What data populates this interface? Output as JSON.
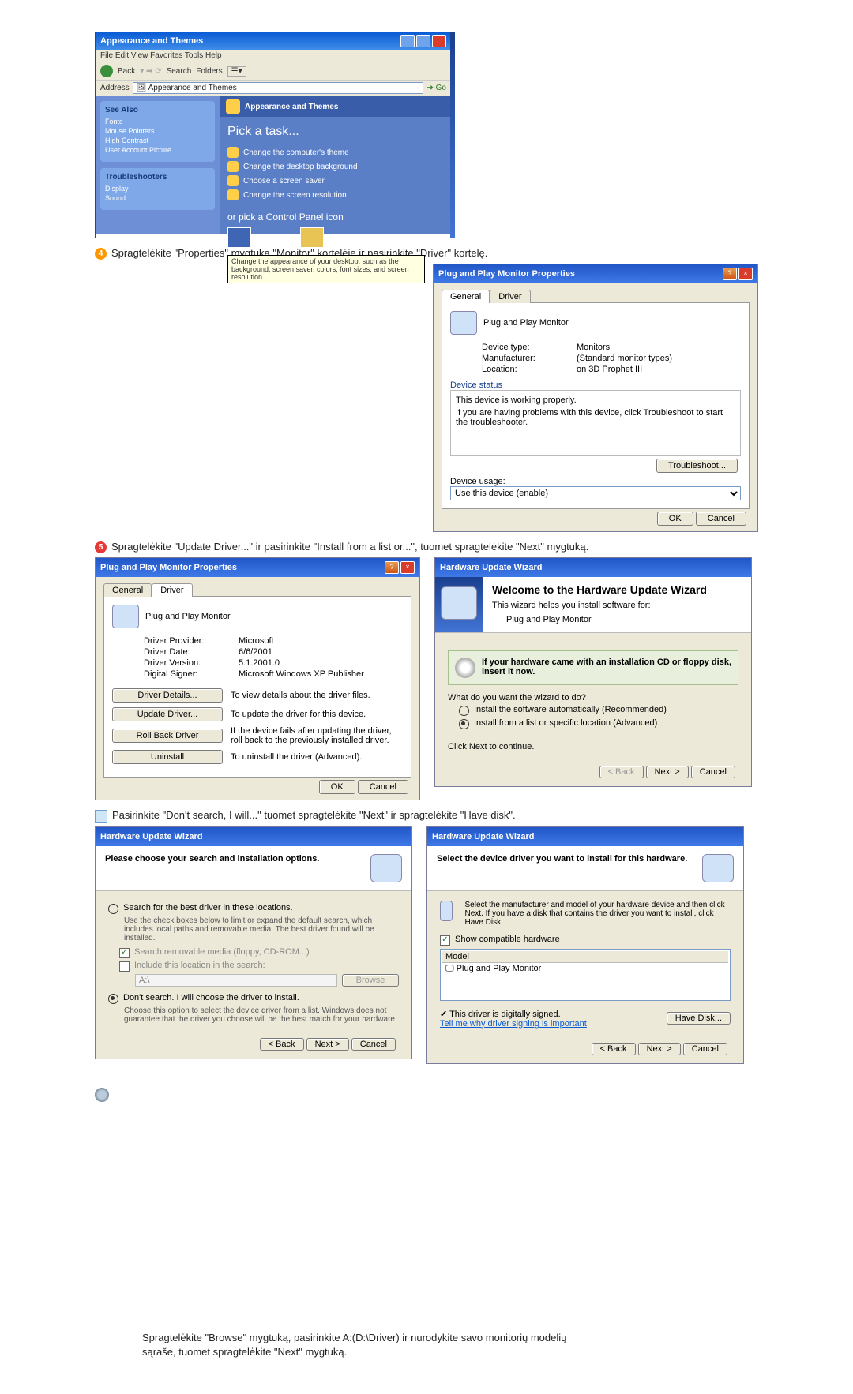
{
  "cp": {
    "title": "Appearance and Themes",
    "menu": "File  Edit  View  Favorites  Tools  Help",
    "back": "Back",
    "search": "Search",
    "folders": "Folders",
    "address_label": "Address",
    "address_value": "Appearance and Themes",
    "go": "Go",
    "side_seealso_hdr": "See Also",
    "side_seealso": [
      "Fonts",
      "Mouse Pointers",
      "High Contrast",
      "User Account Picture"
    ],
    "side_trouble_hdr": "Troubleshooters",
    "side_trouble": [
      "Display",
      "Sound"
    ],
    "main_header": "Appearance and Themes",
    "pick_task": "Pick a task...",
    "tasks": [
      "Change the computer's theme",
      "Change the desktop background",
      "Choose a screen saver",
      "Change the screen resolution"
    ],
    "or_pick": "or pick a Control Panel icon",
    "icon_display": "Display",
    "icon_folder": "Folder Options",
    "tooltip": "Change the appearance of your desktop, such as the background, screen saver, colors, font sizes, and screen resolution."
  },
  "instr4": "Spragtelėkite \"Properties\" mygtuką \"Monitor\" kortelėje ir pasirinkite \"Driver\" kortelę.",
  "props1": {
    "title": "Plug and Play Monitor Properties",
    "tab_general": "General",
    "tab_driver": "Driver",
    "heading": "Plug and Play Monitor",
    "devtype_k": "Device type:",
    "devtype_v": "Monitors",
    "manu_k": "Manufacturer:",
    "manu_v": "(Standard monitor types)",
    "loc_k": "Location:",
    "loc_v": "on 3D Prophet III",
    "status_hdr": "Device status",
    "status1": "This device is working properly.",
    "status2": "If you are having problems with this device, click Troubleshoot to start the troubleshooter.",
    "troubleshoot": "Troubleshoot...",
    "usage_lbl": "Device usage:",
    "usage_val": "Use this device (enable)",
    "ok": "OK",
    "cancel": "Cancel"
  },
  "instr5": "Spragtelėkite \"Update Driver...\" ir pasirinkite \"Install from a list or...\", tuomet spragtelėkite \"Next\" mygtuką.",
  "props2": {
    "title": "Plug and Play Monitor Properties",
    "tab_general": "General",
    "tab_driver": "Driver",
    "heading": "Plug and Play Monitor",
    "provider_k": "Driver Provider:",
    "provider_v": "Microsoft",
    "date_k": "Driver Date:",
    "date_v": "6/6/2001",
    "ver_k": "Driver Version:",
    "ver_v": "5.1.2001.0",
    "signer_k": "Digital Signer:",
    "signer_v": "Microsoft Windows XP Publisher",
    "btn_details": "Driver Details...",
    "btn_details_desc": "To view details about the driver files.",
    "btn_update": "Update Driver...",
    "btn_update_desc": "To update the driver for this device.",
    "btn_rollback": "Roll Back Driver",
    "btn_rollback_desc": "If the device fails after updating the driver, roll back to the previously installed driver.",
    "btn_uninstall": "Uninstall",
    "btn_uninstall_desc": "To uninstall the driver (Advanced).",
    "ok": "OK",
    "cancel": "Cancel"
  },
  "wiz1": {
    "title": "Hardware Update Wizard",
    "welcome": "Welcome to the Hardware Update Wizard",
    "intro": "This wizard helps you install software for:",
    "device": "Plug and Play Monitor",
    "cd_msg": "If your hardware came with an installation CD or floppy disk, insert it now.",
    "q": "What do you want the wizard to do?",
    "opt_auto": "Install the software automatically (Recommended)",
    "opt_list": "Install from a list or specific location (Advanced)",
    "cont": "Click Next to continue.",
    "back": "< Back",
    "next": "Next >",
    "cancel": "Cancel"
  },
  "instr6": "Pasirinkite \"Don't search, I will...\" tuomet spragtelėkite \"Next\" ir spragtelėkite \"Have disk\".",
  "wiz2": {
    "title": "Hardware Update Wizard",
    "heading": "Please choose your search and installation options.",
    "opt_search": "Search for the best driver in these locations.",
    "opt_search_desc": "Use the check boxes below to limit or expand the default search, which includes local paths and removable media. The best driver found will be installed.",
    "chk_removable": "Search removable media (floppy, CD-ROM...)",
    "chk_include": "Include this location in the search:",
    "path": "A:\\",
    "browse": "Browse",
    "opt_dont": "Don't search. I will choose the driver to install.",
    "opt_dont_desc": "Choose this option to select the device driver from a list. Windows does not guarantee that the driver you choose will be the best match for your hardware.",
    "back": "< Back",
    "next": "Next >",
    "cancel": "Cancel"
  },
  "wiz3": {
    "title": "Hardware Update Wizard",
    "heading": "Select the device driver you want to install for this hardware.",
    "desc": "Select the manufacturer and model of your hardware device and then click Next. If you have a disk that contains the driver you want to install, click Have Disk.",
    "show_compat": "Show compatible hardware",
    "model_hdr": "Model",
    "model_item": "Plug and Play Monitor",
    "signed": "This driver is digitally signed.",
    "tellme": "Tell me why driver signing is important",
    "havedisk": "Have Disk...",
    "back": "< Back",
    "next": "Next >",
    "cancel": "Cancel"
  },
  "instr7a": "Spragtelėkite \"Browse\" mygtuką, pasirinkite A:(D:\\Driver) ir nurodykite savo monitorių modelių",
  "instr7b": "sąraše, tuomet spragtelėkite \"Next\" mygtuką."
}
